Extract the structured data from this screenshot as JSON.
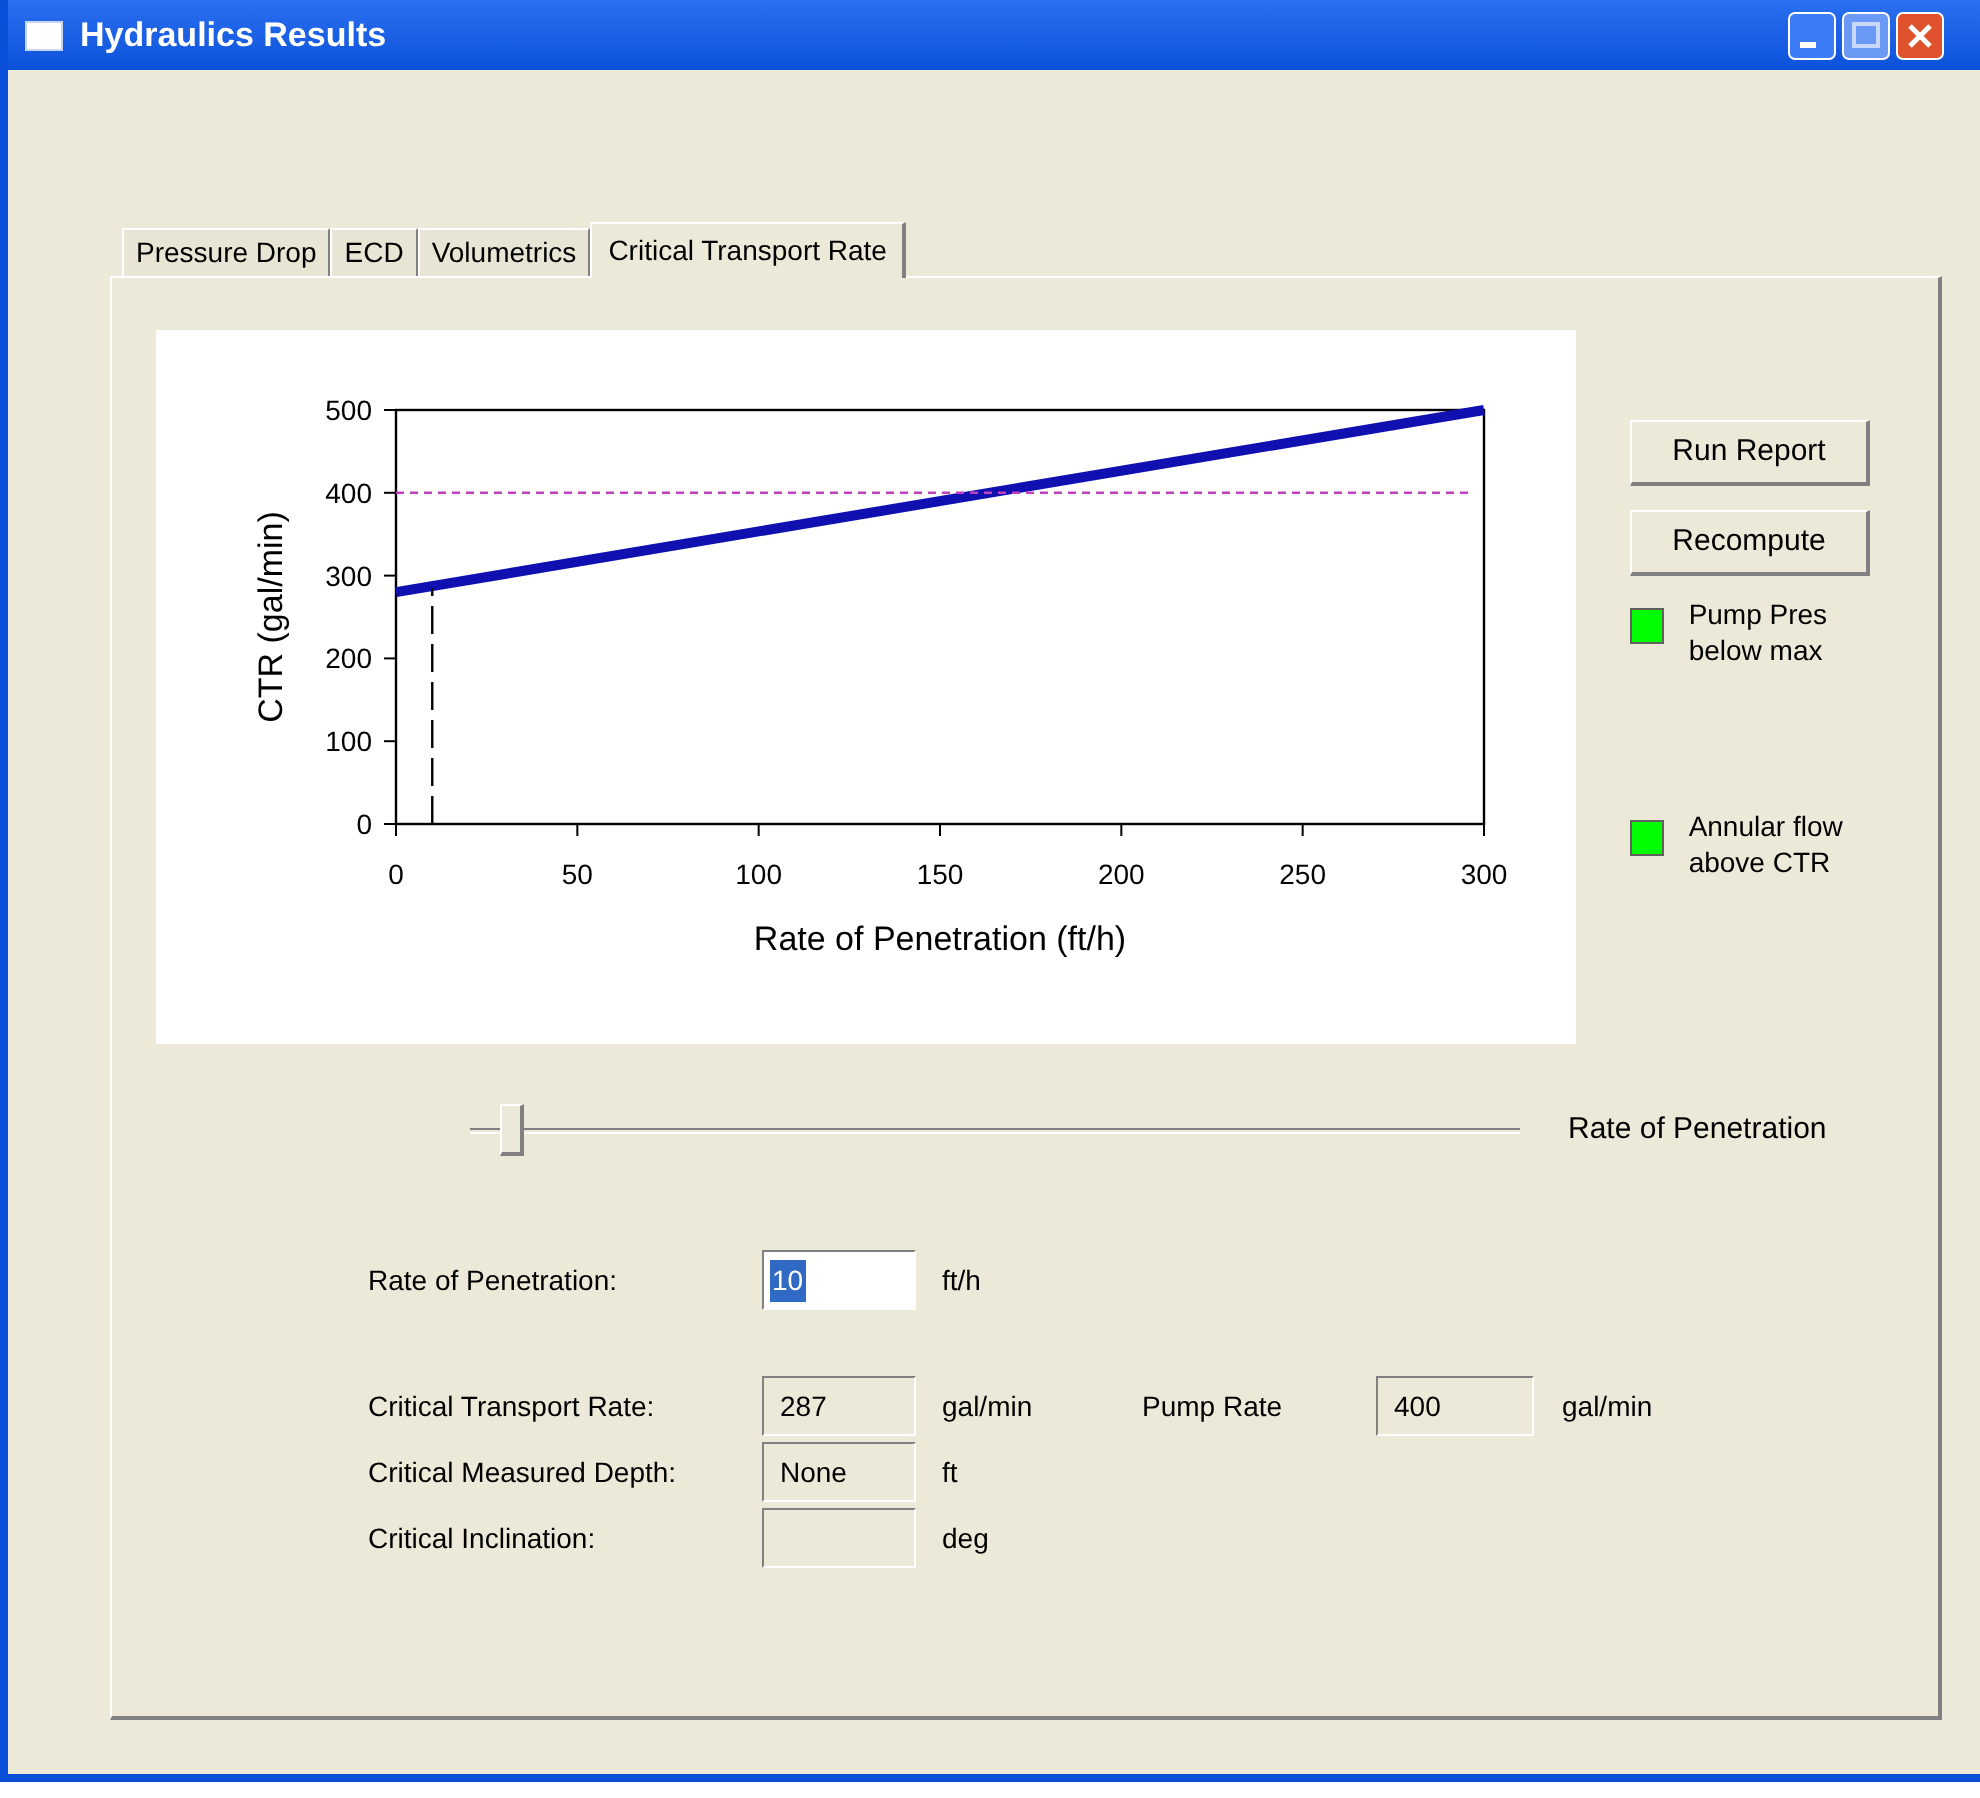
{
  "window": {
    "title": "Hydraulics Results"
  },
  "tabs": [
    {
      "label": "Pressure Drop",
      "selected": false
    },
    {
      "label": "ECD",
      "selected": false
    },
    {
      "label": "Volumetrics",
      "selected": false
    },
    {
      "label": "Critical Transport Rate",
      "selected": true
    }
  ],
  "chart": {
    "chart_data": {
      "type": "line",
      "xlabel": "Rate of Penetration (ft/h)",
      "ylabel": "CTR (gal/min)",
      "xlim": [
        0,
        300
      ],
      "ylim": [
        0,
        500
      ],
      "xticks": [
        0,
        50,
        100,
        150,
        200,
        250,
        300
      ],
      "yticks": [
        0,
        100,
        200,
        300,
        400,
        500
      ],
      "series": [
        {
          "color": "#1010b0",
          "line_style": "solid",
          "x": [
            0,
            300
          ],
          "values": [
            280,
            500
          ]
        },
        {
          "color": "#c040c0",
          "line_style": "dotted",
          "x": [
            0,
            296
          ],
          "values": [
            400,
            400
          ]
        },
        {
          "color": "#000000",
          "line_style": "dashed",
          "x": [
            10,
            10
          ],
          "values": [
            0,
            285
          ]
        }
      ]
    }
  },
  "buttons": [
    "Run Report",
    "Recompute"
  ],
  "indicators": [
    {
      "label": "Pump Pres below max",
      "color": "#00ff00"
    },
    {
      "label": "Annular flow above CTR",
      "color": "#00ff00"
    }
  ],
  "slider": {
    "label": "Rate of Penetration",
    "level": 0.04
  },
  "rop": {
    "label": "Rate of Penetration:",
    "value": "10",
    "unit": "ft/h"
  },
  "results": [
    {
      "label": "Critical Transport Rate:",
      "value": "287",
      "unit": "gal/min"
    },
    {
      "label": "Critical Measured Depth:",
      "value": "None",
      "unit": "ft"
    },
    {
      "label": "Critical Inclination:",
      "unit": "deg"
    }
  ],
  "pump": {
    "label": "Pump Rate",
    "value": "400",
    "unit": "gal/min"
  }
}
